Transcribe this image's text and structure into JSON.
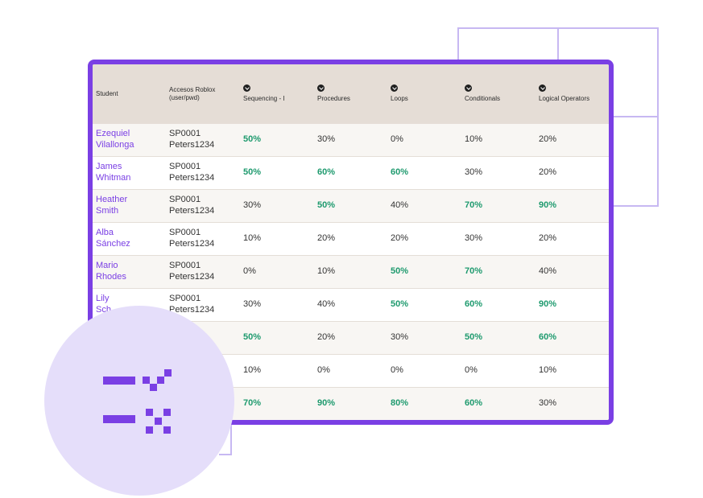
{
  "table": {
    "headers": [
      {
        "label": "Student",
        "icon": false
      },
      {
        "label": "Accesos Roblox (user/pwd)",
        "icon": false
      },
      {
        "label": "Sequencing - I",
        "icon": true
      },
      {
        "label": "Procedures",
        "icon": true
      },
      {
        "label": "Loops",
        "icon": true
      },
      {
        "label": "Conditionals",
        "icon": true
      },
      {
        "label": "Logical Operators",
        "icon": true
      }
    ],
    "rows": [
      {
        "first": "Ezequiel",
        "last": "Vilallonga",
        "user": "SP0001",
        "pwd": "Peters1234",
        "scores": [
          {
            "v": "50%",
            "hi": true
          },
          {
            "v": "30%",
            "hi": false
          },
          {
            "v": "0%",
            "hi": false
          },
          {
            "v": "10%",
            "hi": false
          },
          {
            "v": "20%",
            "hi": false
          }
        ]
      },
      {
        "first": "James",
        "last": "Whitman",
        "user": "SP0001",
        "pwd": "Peters1234",
        "scores": [
          {
            "v": "50%",
            "hi": true
          },
          {
            "v": "60%",
            "hi": true
          },
          {
            "v": "60%",
            "hi": true
          },
          {
            "v": "30%",
            "hi": false
          },
          {
            "v": "20%",
            "hi": false
          }
        ]
      },
      {
        "first": "Heather",
        "last": "Smith",
        "user": "SP0001",
        "pwd": "Peters1234",
        "scores": [
          {
            "v": "30%",
            "hi": false
          },
          {
            "v": "50%",
            "hi": true
          },
          {
            "v": "40%",
            "hi": false
          },
          {
            "v": "70%",
            "hi": true
          },
          {
            "v": "90%",
            "hi": true
          }
        ]
      },
      {
        "first": "Alba",
        "last": "Sánchez",
        "user": "SP0001",
        "pwd": "Peters1234",
        "scores": [
          {
            "v": "10%",
            "hi": false
          },
          {
            "v": "20%",
            "hi": false
          },
          {
            "v": "20%",
            "hi": false
          },
          {
            "v": "30%",
            "hi": false
          },
          {
            "v": "20%",
            "hi": false
          }
        ]
      },
      {
        "first": "Mario",
        "last": "Rhodes",
        "user": "SP0001",
        "pwd": "Peters1234",
        "scores": [
          {
            "v": "0%",
            "hi": false
          },
          {
            "v": "10%",
            "hi": false
          },
          {
            "v": "50%",
            "hi": true
          },
          {
            "v": "70%",
            "hi": true
          },
          {
            "v": "40%",
            "hi": false
          }
        ]
      },
      {
        "first": "Lily",
        "last": "Sch",
        "user": "SP0001",
        "pwd": "Peters1234",
        "scores": [
          {
            "v": "30%",
            "hi": false
          },
          {
            "v": "40%",
            "hi": false
          },
          {
            "v": "50%",
            "hi": true
          },
          {
            "v": "60%",
            "hi": true
          },
          {
            "v": "90%",
            "hi": true
          }
        ]
      },
      {
        "first": "",
        "last": "",
        "user": "",
        "pwd": "",
        "scores": [
          {
            "v": "50%",
            "hi": true
          },
          {
            "v": "20%",
            "hi": false
          },
          {
            "v": "30%",
            "hi": false
          },
          {
            "v": "50%",
            "hi": true
          },
          {
            "v": "60%",
            "hi": true
          }
        ]
      },
      {
        "first": "",
        "last": "",
        "user": "",
        "pwd": "",
        "scores": [
          {
            "v": "10%",
            "hi": false
          },
          {
            "v": "0%",
            "hi": false
          },
          {
            "v": "0%",
            "hi": false
          },
          {
            "v": "0%",
            "hi": false
          },
          {
            "v": "10%",
            "hi": false
          }
        ]
      },
      {
        "first": "",
        "last": "",
        "user": "",
        "pwd": "",
        "scores": [
          {
            "v": "70%",
            "hi": true
          },
          {
            "v": "90%",
            "hi": true
          },
          {
            "v": "80%",
            "hi": true
          },
          {
            "v": "60%",
            "hi": true
          },
          {
            "v": "30%",
            "hi": false
          }
        ]
      }
    ]
  },
  "colors": {
    "accent": "#7a3fe4",
    "positive": "#1e9a6e",
    "header_bg": "#e5ddd6"
  },
  "overlay": {
    "icon": "grade-check-cross-icon"
  }
}
